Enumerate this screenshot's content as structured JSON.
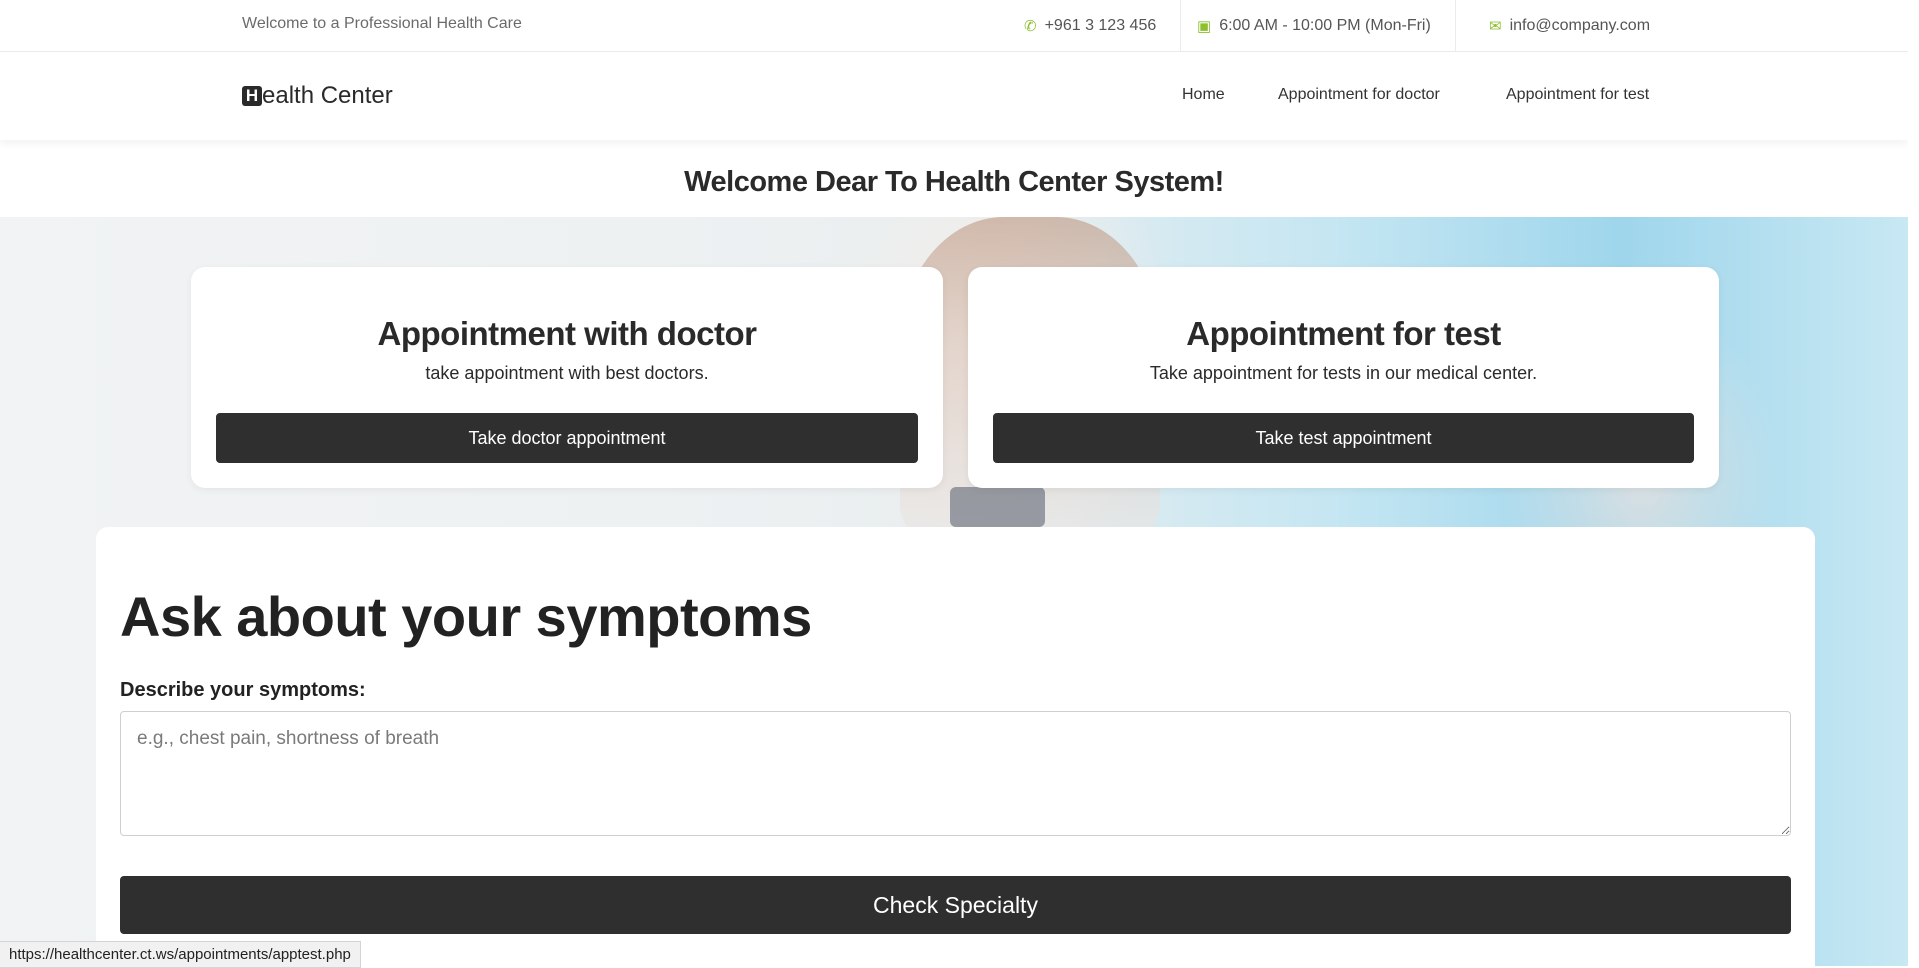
{
  "topbar": {
    "welcome": "Welcome to a Professional Health Care",
    "phone": "+961 3 123 456",
    "hours": "6:00 AM - 10:00 PM (Mon-Fri)",
    "email": "info@company.com",
    "icon_color": "#8dbf2f"
  },
  "brand": {
    "mark": "H",
    "name": "ealth Center"
  },
  "nav": {
    "home": "Home",
    "doctor": "Appointment for doctor",
    "test": "Appointment for test"
  },
  "welcome_title": "Welcome Dear To Health Center System!",
  "cards": {
    "doctor": {
      "title": "Appointment with doctor",
      "text": "take appointment with best doctors.",
      "button": "Take doctor appointment"
    },
    "test": {
      "title": "Appointment for test",
      "text": "Take appointment for tests in our medical center.",
      "button": "Take test appointment"
    }
  },
  "symptoms": {
    "title": "Ask about your symptoms",
    "label": "Describe your symptoms:",
    "placeholder": "e.g., chest pain, shortness of breath",
    "value": "",
    "button": "Check Specialty"
  },
  "status_url": "https://healthcenter.ct.ws/appointments/apptest.php",
  "colors": {
    "button_bg": "#2f2f2f",
    "accent": "#8dbf2f"
  }
}
